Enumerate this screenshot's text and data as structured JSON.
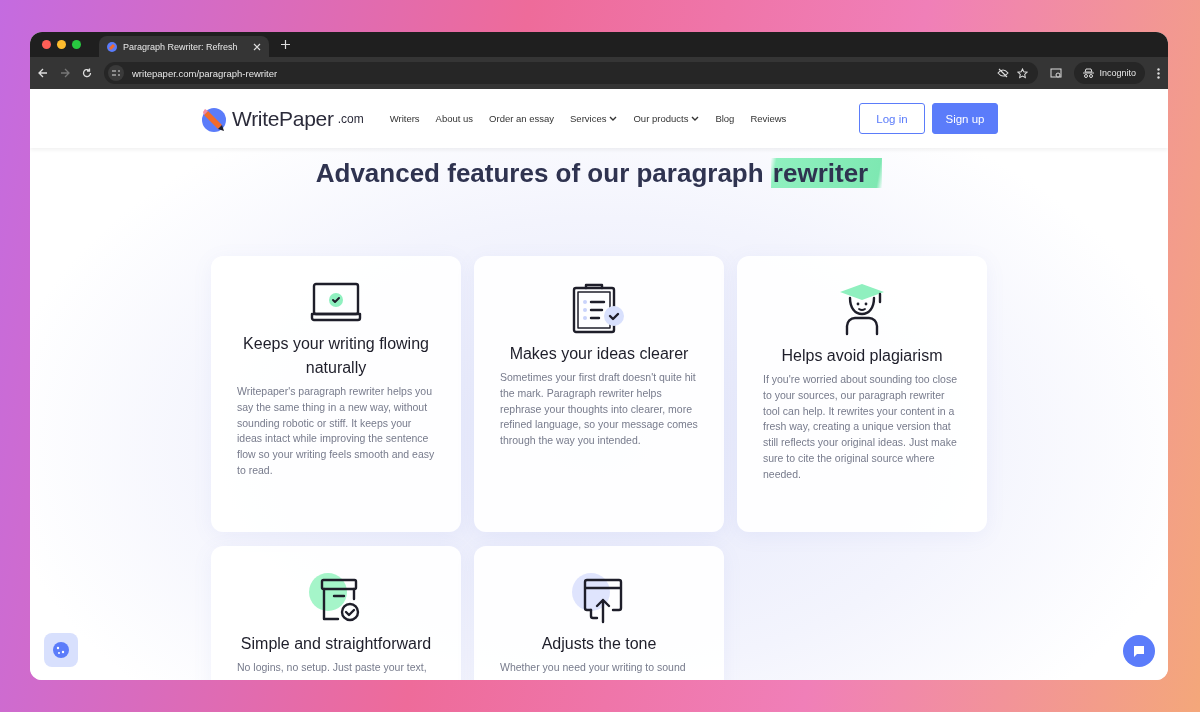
{
  "browser": {
    "tab_title": "Paragraph Rewriter: Refresh",
    "url": "writepaper.com/paragraph-rewriter",
    "profile": "Incognito"
  },
  "header": {
    "logo": {
      "name": "WritePaper",
      "suffix": ".com"
    },
    "nav": [
      {
        "label": "Writers",
        "has_menu": false
      },
      {
        "label": "About us",
        "has_menu": false
      },
      {
        "label": "Order an essay",
        "has_menu": false
      },
      {
        "label": "Services",
        "has_menu": true
      },
      {
        "label": "Our products",
        "has_menu": true
      },
      {
        "label": "Blog",
        "has_menu": false
      },
      {
        "label": "Reviews",
        "has_menu": false
      }
    ],
    "buttons": [
      {
        "label": "Log in",
        "kind": "outline"
      },
      {
        "label": "Sign up",
        "kind": "filled"
      }
    ]
  },
  "heading": {
    "text": "Advanced features of our paragraph",
    "highlight": "rewriter"
  },
  "features": [
    {
      "title": "Keeps your writing flowing naturally",
      "text": "Writepaper's paragraph rewriter helps you say the same thing in a new way, without sounding robotic or stiff. It keeps your ideas intact while improving the sentence flow so your writing feels smooth and easy to read."
    },
    {
      "title": "Makes your ideas clearer",
      "text": "Sometimes your first draft doesn't quite hit the mark. Paragraph rewriter helps rephrase your thoughts into clearer, more refined language, so your message comes through the way you intended."
    },
    {
      "title": "Helps avoid plagiarism",
      "text": "If you're worried about sounding too close to your sources, our paragraph rewriter tool can help. It rewrites your content in a fresh way, creating a unique version that still reflects your original ideas. Just make sure to cite the original source where needed."
    },
    {
      "title": "Simple and straightforward",
      "text": "No logins, no setup. Just paste your text,"
    },
    {
      "title": "Adjusts the tone",
      "text": "Whether you need your writing to sound"
    }
  ]
}
